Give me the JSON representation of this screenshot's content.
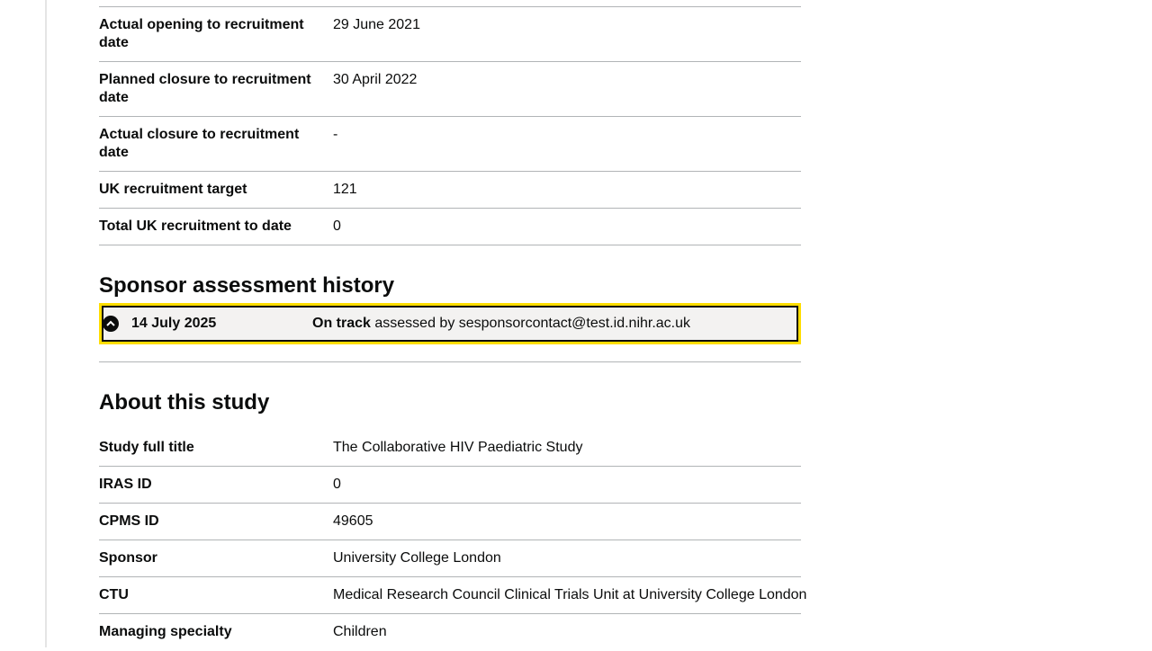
{
  "recruitment": [
    {
      "key": "Actual opening to recruitment date",
      "value": "29 June 2021"
    },
    {
      "key": "Planned closure to recruitment date",
      "value": "30 April 2022"
    },
    {
      "key": "Actual closure to recruitment date",
      "value": "-"
    },
    {
      "key": "UK recruitment target",
      "value": "121"
    },
    {
      "key": "Total UK recruitment to date",
      "value": "0"
    }
  ],
  "assessment": {
    "heading": "Sponsor assessment history",
    "entry": {
      "date": "14 July 2025",
      "status": "On track",
      "assessed_by_text": "assessed by sesponsorcontact@test.id.nihr.ac.uk",
      "toggle_icon": "chevron-up-icon"
    }
  },
  "about": {
    "heading": "About this study",
    "rows": [
      {
        "key": "Study full title",
        "value": "The Collaborative HIV Paediatric Study"
      },
      {
        "key": "IRAS ID",
        "value": "0"
      },
      {
        "key": "CPMS ID",
        "value": "49605"
      },
      {
        "key": "Sponsor",
        "value": "University College London"
      },
      {
        "key": "CTU",
        "value": "Medical Research Council Clinical Trials Unit at University College London"
      },
      {
        "key": "Managing specialty",
        "value": "Children"
      }
    ]
  },
  "colors": {
    "focus": "#ffdd00",
    "text": "#0b0c0c",
    "border": "#b1b4b6",
    "panel": "#f3f2f1"
  }
}
